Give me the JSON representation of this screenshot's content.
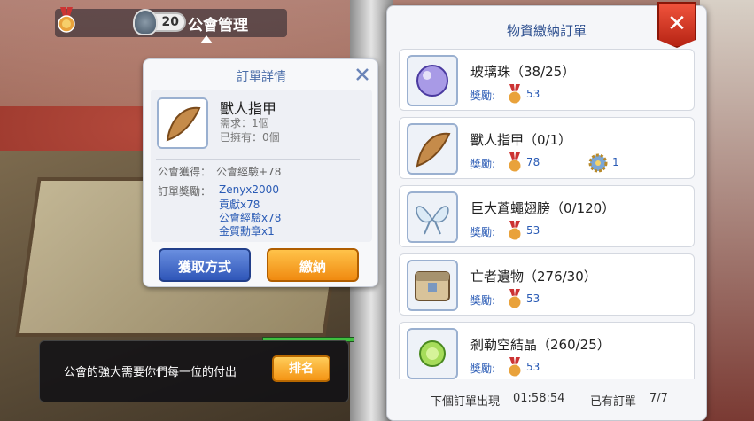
{
  "header": {
    "level": "20",
    "title": "公會管理"
  },
  "detail": {
    "title": "訂單詳情",
    "item_name": "獸人指甲",
    "required": "需求：1個",
    "owned": "已擁有：0個",
    "gain_label": "公會獲得：",
    "gain_value": "公會經驗+78",
    "reward_label": "訂單獎勵：",
    "rewards": [
      "Zenyx2000",
      "貢獻x78",
      "公會經驗x78",
      "金質勳章x1"
    ],
    "btn_obtain": "獲取方式",
    "btn_submit": "繳納"
  },
  "orders": {
    "title": "物資繳納訂單",
    "reward_label": "獎勵:",
    "items": [
      {
        "name": "玻璃珠（38/25）",
        "medal": "53"
      },
      {
        "name": "獸人指甲（0/1）",
        "medal": "78",
        "extra": "1"
      },
      {
        "name": "巨大蒼蠅翅膀（0/120）",
        "medal": "53"
      },
      {
        "name": "亡者遺物（276/30）",
        "medal": "53"
      },
      {
        "name": "剎勒空結晶（260/25）",
        "medal": "53"
      }
    ],
    "next_label": "下個訂單出現",
    "next_time": "01:58:54",
    "have_label": "已有訂單",
    "have_count": "7/7"
  },
  "banner": {
    "text": "公會的強大需要你們每一位的付出",
    "rank_button": "排名"
  },
  "colors": {
    "accent_blue": "#2a5bb5",
    "close_red": "#d63a24",
    "button_orange": "#f08a10"
  }
}
